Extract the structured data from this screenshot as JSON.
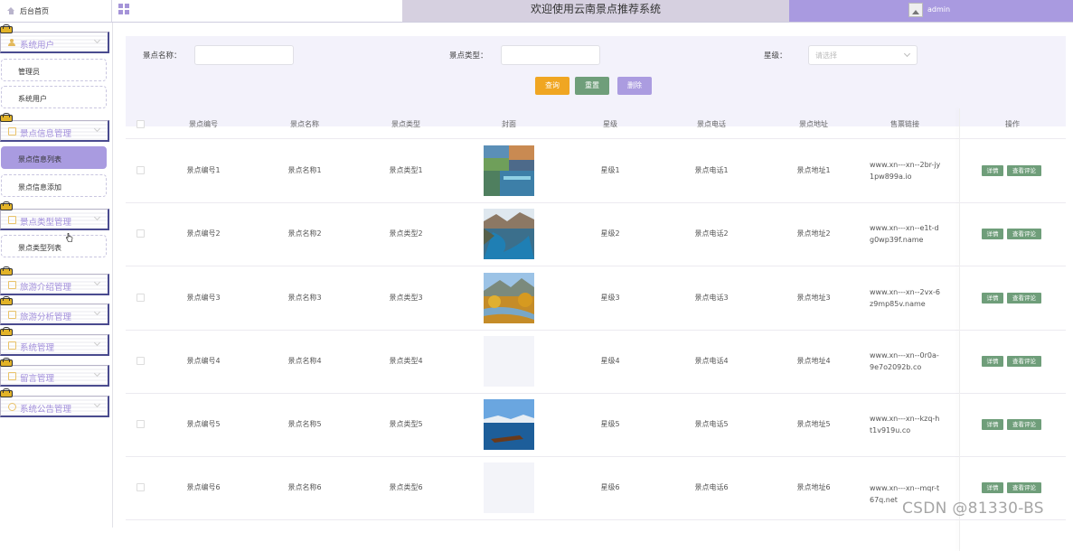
{
  "header": {
    "brand": "后台首页",
    "site_title": "欢迎使用云南景点推荐系统",
    "user": "admin"
  },
  "sidebar": {
    "groups": [
      {
        "label": "系统用户",
        "items": [
          "管理员",
          "系统用户"
        ]
      },
      {
        "label": "景点信息管理",
        "items": [
          "景点信息列表",
          "景点信息添加"
        ]
      },
      {
        "label": "景点类型管理",
        "items": [
          "景点类型列表"
        ]
      },
      {
        "label": "旅游介绍管理",
        "items": []
      },
      {
        "label": "旅游分析管理",
        "items": []
      },
      {
        "label": "系统管理",
        "items": []
      },
      {
        "label": "留言管理",
        "items": []
      },
      {
        "label": "系统公告管理",
        "items": []
      }
    ],
    "active_item": "景点信息列表"
  },
  "filters": {
    "name_label": "景点名称：",
    "type_label": "景点类型：",
    "level_label": "星级：",
    "level_placeholder": "请选择",
    "name_value": "",
    "type_value": ""
  },
  "buttons": {
    "query": "查询",
    "reset": "重置",
    "delete": "删除"
  },
  "table": {
    "columns": [
      "景点编号",
      "景点名称",
      "景点类型",
      "封面",
      "星级",
      "景点电话",
      "景点地址",
      "售票链接",
      "操作"
    ],
    "rows": [
      {
        "code": "景点编号1",
        "name": "景点名称1",
        "type": "景点类型1",
        "level": "星级1",
        "phone": "景点电话1",
        "address": "景点地址1",
        "link": "www.xn---xn--2br-jy1pw899a.io"
      },
      {
        "code": "景点编号2",
        "name": "景点名称2",
        "type": "景点类型2",
        "level": "星级2",
        "phone": "景点电话2",
        "address": "景点地址2",
        "link": "www.xn---xn--e1t-dg0wp39f.name"
      },
      {
        "code": "景点编号3",
        "name": "景点名称3",
        "type": "景点类型3",
        "level": "星级3",
        "phone": "景点电话3",
        "address": "景点地址3",
        "link": "www.xn---xn--2vx-6z9mp85v.name"
      },
      {
        "code": "景点编号4",
        "name": "景点名称4",
        "type": "景点类型4",
        "level": "星级4",
        "phone": "景点电话4",
        "address": "景点地址4",
        "link": "www.xn---xn--0r0a-9e7o2092b.co"
      },
      {
        "code": "景点编号5",
        "name": "景点名称5",
        "type": "景点类型5",
        "level": "星级5",
        "phone": "景点电话5",
        "address": "景点地址5",
        "link": "www.xn---xn--kzq-ht1v919u.co"
      },
      {
        "code": "景点编号6",
        "name": "景点名称6",
        "type": "景点类型6",
        "level": "星级6",
        "phone": "景点电话6",
        "address": "景点地址6",
        "link": "www.xn---xn--mqr-t67q.net"
      }
    ],
    "row_actions": {
      "detail": "详情",
      "comments": "查看评论"
    }
  },
  "watermark": "CSDN @81330-BS",
  "colors": {
    "accent": "#a99be0",
    "query": "#f0a622",
    "reset": "#6f9e7a",
    "delete": "#ab9ce0"
  }
}
